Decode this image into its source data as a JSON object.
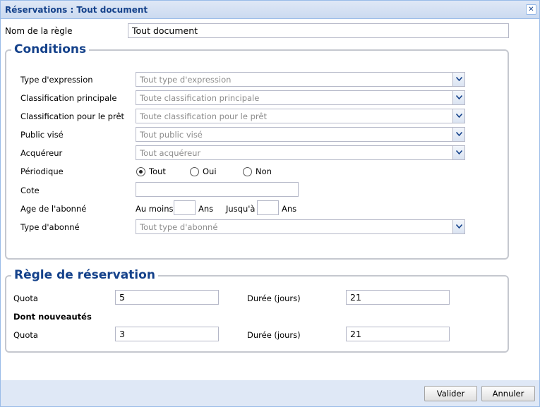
{
  "window": {
    "title": "Réservations : Tout document"
  },
  "rule_name": {
    "label": "Nom de la règle",
    "value": "Tout document"
  },
  "conditions": {
    "legend": "Conditions",
    "expression_type": {
      "label": "Type d'expression",
      "placeholder": "Tout type d'expression"
    },
    "main_classification": {
      "label": "Classification principale",
      "placeholder": "Toute classification principale"
    },
    "loan_classification": {
      "label": "Classification pour le prêt",
      "placeholder": "Toute classification pour le prêt"
    },
    "audience": {
      "label": "Public visé",
      "placeholder": "Tout public visé"
    },
    "acquirer": {
      "label": "Acquéreur",
      "placeholder": "Tout acquéreur"
    },
    "periodic": {
      "label": "Périodique",
      "options": [
        "Tout",
        "Oui",
        "Non"
      ],
      "selected": "Tout"
    },
    "call_number": {
      "label": "Cote",
      "value": ""
    },
    "subscriber_age": {
      "label": "Age de l'abonné",
      "min_label": "Au moins",
      "min_value": "",
      "min_unit": "Ans",
      "max_label": "Jusqu'à",
      "max_value": "",
      "max_unit": "Ans"
    },
    "subscriber_type": {
      "label": "Type d'abonné",
      "placeholder": "Tout type d'abonné"
    }
  },
  "reservation_rule": {
    "legend": "Règle de réservation",
    "quota_label": "Quota",
    "quota_value": "5",
    "duration_label": "Durée (jours)",
    "duration_value": "21",
    "new_items_title": "Dont nouveautés",
    "new_quota_label": "Quota",
    "new_quota_value": "3",
    "new_duration_label": "Durée (jours)",
    "new_duration_value": "21"
  },
  "buttons": {
    "validate": "Valider",
    "cancel": "Annuler"
  },
  "icons": {
    "close": "close-icon",
    "dropdown": "chevron-down-icon"
  },
  "colors": {
    "title_text": "#15428b",
    "header_bg": "#dfe8f6",
    "border": "#99bbe8"
  }
}
